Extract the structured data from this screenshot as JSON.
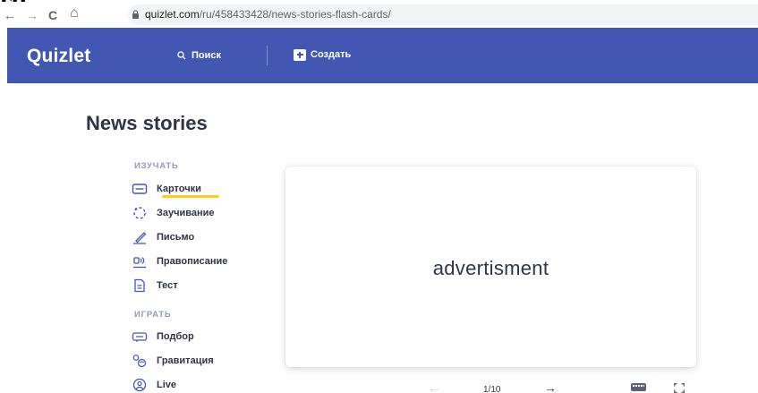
{
  "browser": {
    "clipped_text": "гр",
    "back_glyph": "←",
    "forward_glyph": "→",
    "reload_glyph": "C",
    "home_glyph": "⌂",
    "url_host": "quizlet.com",
    "url_path": "/ru/458433428/news-stories-flash-cards/"
  },
  "header": {
    "logo": "Quizlet",
    "search_label": "Поиск",
    "create_label": "Создать",
    "background": "#4257b2"
  },
  "page": {
    "title": "News stories"
  },
  "study": {
    "label": "ИЗУЧАТЬ",
    "items": [
      {
        "label": "Карточки",
        "icon": "cards-icon",
        "active": true
      },
      {
        "label": "Заучивание",
        "icon": "learn-icon"
      },
      {
        "label": "Письмо",
        "icon": "write-icon"
      },
      {
        "label": "Правописание",
        "icon": "spell-icon"
      },
      {
        "label": "Тест",
        "icon": "test-icon"
      }
    ]
  },
  "play": {
    "label": "ИГРАТЬ",
    "items": [
      {
        "label": "Подбор",
        "icon": "match-icon"
      },
      {
        "label": "Гравитация",
        "icon": "gravity-icon"
      },
      {
        "label": "Live",
        "icon": "live-icon"
      }
    ]
  },
  "flashcard": {
    "term": "advertisment"
  },
  "controls": {
    "prev_glyph": "←",
    "next_glyph": "→",
    "counter": "1/10"
  },
  "colors": {
    "accent_underline": "#ffcd1f",
    "text": "#303545",
    "muted": "#939bb4"
  }
}
